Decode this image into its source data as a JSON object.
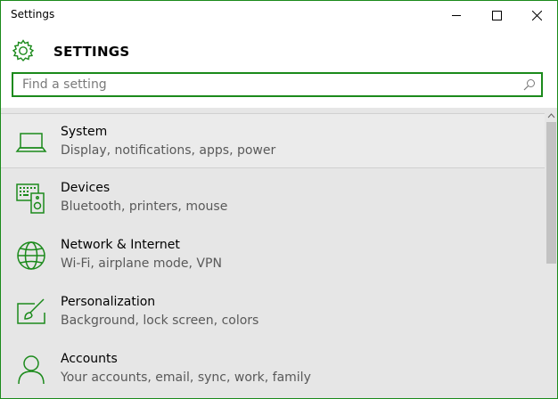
{
  "window": {
    "title": "Settings",
    "minimize_icon": "minimize-icon",
    "maximize_icon": "maximize-icon",
    "close_icon": "close-icon"
  },
  "header": {
    "icon": "gear-icon",
    "title": "SETTINGS"
  },
  "search": {
    "placeholder": "Find a setting",
    "value": "",
    "icon": "search-icon"
  },
  "categories": [
    {
      "name": "System",
      "description": "Display, notifications, apps, power",
      "icon": "laptop-icon",
      "selected": true
    },
    {
      "name": "Devices",
      "description": "Bluetooth, printers, mouse",
      "icon": "devices-icon",
      "selected": false
    },
    {
      "name": "Network & Internet",
      "description": "Wi-Fi, airplane mode, VPN",
      "icon": "globe-icon",
      "selected": false
    },
    {
      "name": "Personalization",
      "description": "Background, lock screen, colors",
      "icon": "personalization-icon",
      "selected": false
    },
    {
      "name": "Accounts",
      "description": "Your accounts, email, sync, work, family",
      "icon": "person-icon",
      "selected": false
    }
  ],
  "colors": {
    "accent": "#1b8a1b",
    "background": "#e6e6e6",
    "description_text": "#595959"
  }
}
